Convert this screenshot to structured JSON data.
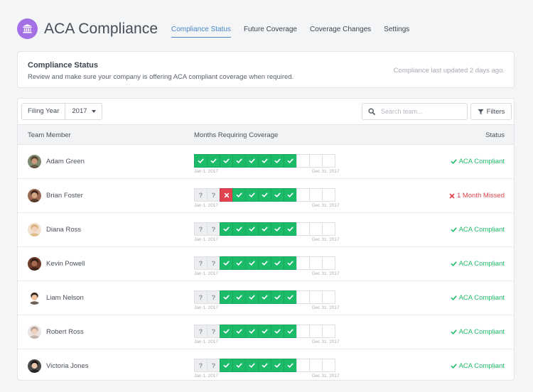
{
  "header": {
    "title": "ACA Compliance",
    "logo_icon": "building-columns-icon",
    "tabs": [
      {
        "label": "Compliance Status",
        "active": true
      },
      {
        "label": "Future Coverage",
        "active": false
      },
      {
        "label": "Coverage Changes",
        "active": false
      },
      {
        "label": "Settings",
        "active": false
      }
    ]
  },
  "status_card": {
    "title": "Compliance Status",
    "description": "Review and make sure your company is offering ACA compliant coverage when required.",
    "updated": "Compliance last updated 2 days ago."
  },
  "toolbar": {
    "filing_label": "Filing Year",
    "year": "2017",
    "search_placeholder": "Search team...",
    "filters_label": "Filters"
  },
  "table": {
    "headers": {
      "member": "Team Member",
      "months": "Months Requiring Coverage",
      "status": "Status"
    },
    "start_label": "Jan 1, 2017",
    "end_label": "Dec 31, 2017",
    "rows": [
      {
        "name": "Adam Green",
        "months": [
          "covered",
          "covered",
          "covered",
          "covered",
          "covered",
          "covered",
          "covered",
          "covered",
          "future",
          "future",
          "future"
        ],
        "status": "ACA Compliant",
        "status_type": "ok",
        "avatar": {
          "skin": "#c89a7a",
          "hair": "#5b4636",
          "bg": "#7d8a6e"
        }
      },
      {
        "name": "Brian Foster",
        "months": [
          "unknown",
          "unknown",
          "missed",
          "covered",
          "covered",
          "covered",
          "covered",
          "covered",
          "future",
          "future",
          "future"
        ],
        "status": "1 Month Missed",
        "status_type": "bad",
        "avatar": {
          "skin": "#d3a584",
          "hair": "#3a2a22",
          "bg": "#9a6b52"
        }
      },
      {
        "name": "Diana Ross",
        "months": [
          "unknown",
          "unknown",
          "covered",
          "covered",
          "covered",
          "covered",
          "covered",
          "covered",
          "future",
          "future",
          "future"
        ],
        "status": "ACA Compliant",
        "status_type": "ok",
        "avatar": {
          "skin": "#f2d2bd",
          "hair": "#d9b07a",
          "bg": "#f0e2cf"
        }
      },
      {
        "name": "Kevin Powell",
        "months": [
          "unknown",
          "unknown",
          "covered",
          "covered",
          "covered",
          "covered",
          "covered",
          "covered",
          "future",
          "future",
          "future"
        ],
        "status": "ACA Compliant",
        "status_type": "ok",
        "avatar": {
          "skin": "#a86b4d",
          "hair": "#2d1e17",
          "bg": "#6e3b2a"
        }
      },
      {
        "name": "Liam Nelson",
        "months": [
          "unknown",
          "unknown",
          "covered",
          "covered",
          "covered",
          "covered",
          "covered",
          "covered",
          "future",
          "future",
          "future"
        ],
        "status": "ACA Compliant",
        "status_type": "ok",
        "avatar": {
          "skin": "#edc3a3",
          "hair": "#3b2b1f",
          "bg": "#ffffff"
        }
      },
      {
        "name": "Robert Ross",
        "months": [
          "unknown",
          "unknown",
          "covered",
          "covered",
          "covered",
          "covered",
          "covered",
          "covered",
          "future",
          "future",
          "future"
        ],
        "status": "ACA Compliant",
        "status_type": "ok",
        "avatar": {
          "skin": "#f0d0bc",
          "hair": "#b7a497",
          "bg": "#e9e4e1"
        }
      },
      {
        "name": "Victoria Jones",
        "months": [
          "unknown",
          "unknown",
          "covered",
          "covered",
          "covered",
          "covered",
          "covered",
          "covered",
          "future",
          "future",
          "future"
        ],
        "status": "ACA Compliant",
        "status_type": "ok",
        "avatar": {
          "skin": "#e8c6ae",
          "hair": "#1f1a18",
          "bg": "#4a4a4a"
        }
      }
    ]
  },
  "colors": {
    "accent": "#4a86c8",
    "logo": "#a470e6",
    "covered": "#1cbb6a",
    "missed": "#e0434f"
  }
}
